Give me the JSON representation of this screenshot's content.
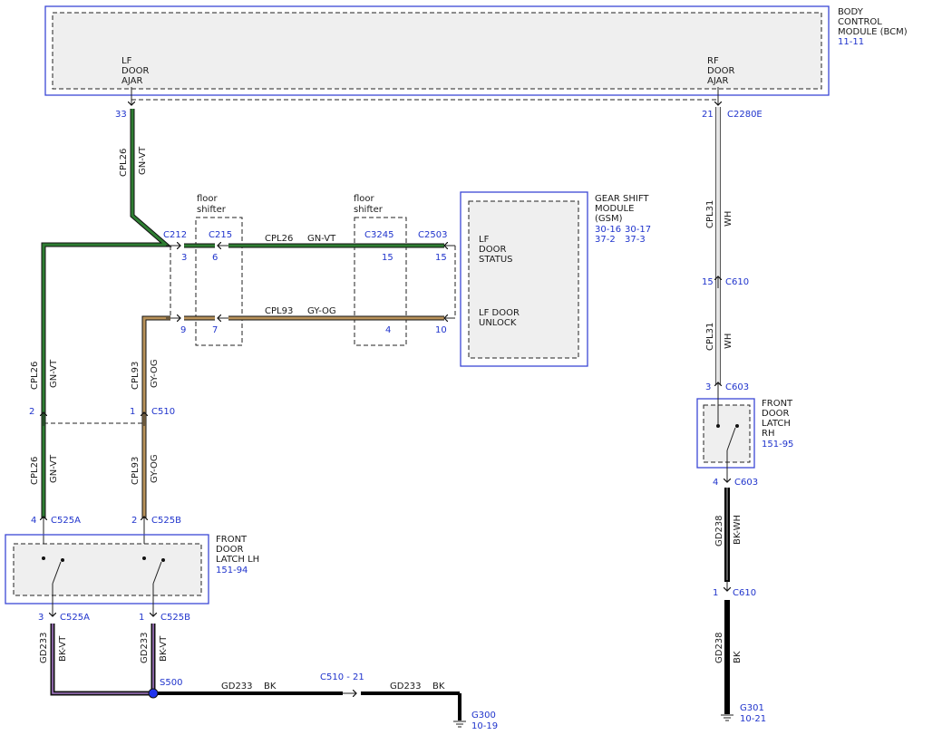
{
  "modules": {
    "bcm": {
      "name": [
        "BODY",
        "CONTROL",
        "MODULE (BCM)"
      ],
      "ref": "11-11",
      "lf_pin": [
        "LF",
        "DOOR",
        "AJAR"
      ],
      "rf_pin": [
        "RF",
        "DOOR",
        "AJAR"
      ]
    },
    "gsm": {
      "name": [
        "GEAR SHIFT",
        "MODULE",
        "(GSM)"
      ],
      "refs": [
        "30-16",
        "30-17",
        "37-2",
        "37-3"
      ],
      "pin1": [
        "LF",
        "DOOR",
        "STATUS"
      ],
      "pin2": [
        "LF DOOR",
        "UNLOCK"
      ]
    },
    "latch_lh": {
      "name": [
        "FRONT",
        "DOOR",
        "LATCH LH"
      ],
      "ref": "151-94"
    },
    "latch_rh": {
      "name": [
        "FRONT",
        "DOOR",
        "LATCH",
        "RH"
      ],
      "ref": "151-95"
    }
  },
  "floor_shifter_label": [
    "floor",
    "shifter"
  ],
  "connectors": {
    "bcm_lf_pin": "33",
    "bcm_rf_pin": "21",
    "c2280e": "C2280E",
    "c212": "C212",
    "c212_pin1": "3",
    "c212_pin2": "9",
    "c215": "C215",
    "c215_pin1": "6",
    "c215_pin2": "7",
    "c3245": "C3245",
    "c3245_pin1": "15",
    "c3245_pin2": "4",
    "c2503": "C2503",
    "c2503_pin1": "15",
    "c2503_pin2": "10",
    "c510": "C510",
    "c510_pin_a": "2",
    "c510_pin_b": "1",
    "c525a_top": "C525A",
    "c525a_top_pin": "4",
    "c525b_top": "C525B",
    "c525b_top_pin": "2",
    "c525a_bot": "C525A",
    "c525a_bot_pin": "3",
    "c525b_bot": "C525B",
    "c525b_bot_pin": "1",
    "c610_top": "C610",
    "c610_top_pin": "15",
    "c603_top": "C603",
    "c603_top_pin": "3",
    "c603_bot": "C603",
    "c603_bot_pin": "4",
    "c610_bot": "C610",
    "c610_bot_pin": "1",
    "s500": "S500",
    "c510_21": "C510 - 21",
    "g300": "G300",
    "g300_ref": "10-19",
    "g301": "G301",
    "g301_ref": "10-21"
  },
  "wires": {
    "cpl26": "CPL26",
    "gn_vt": "GN-VT",
    "cpl93": "CPL93",
    "gy_og": "GY-OG",
    "cpl31": "CPL31",
    "wh": "WH",
    "gd233": "GD233",
    "bk_vt": "BK-VT",
    "bk": "BK",
    "gd238": "GD238",
    "bk_wh": "BK-WH"
  },
  "colors": {
    "green_wire": "#2e7d32",
    "gray_orange_wire": "#b8925a",
    "white_wire": "#d9d9d9",
    "black_wire": "#000000",
    "violet_stripe": "#a678c8",
    "module_border": "#3b47d6",
    "ref_text": "#1f33cc"
  }
}
